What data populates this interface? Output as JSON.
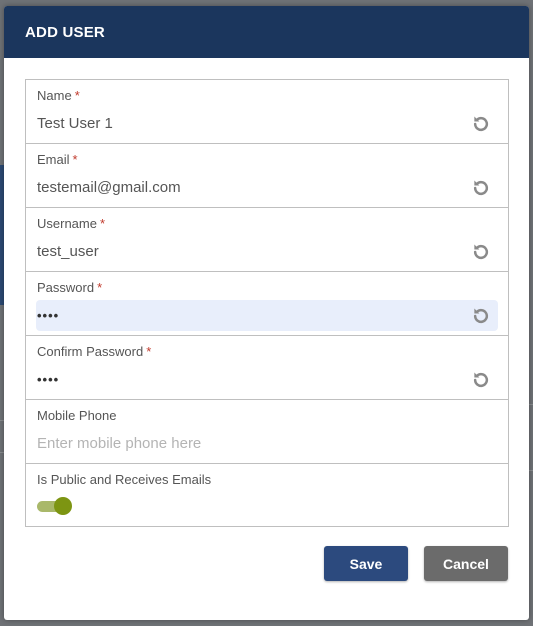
{
  "dialog": {
    "title": "ADD USER"
  },
  "fields": {
    "name": {
      "label": "Name",
      "required": "*",
      "value": "Test User 1"
    },
    "email": {
      "label": "Email",
      "required": "*",
      "value": "testemail@gmail.com"
    },
    "username": {
      "label": "Username",
      "required": "*",
      "value": "test_user"
    },
    "password": {
      "label": "Password",
      "required": "*",
      "value": "••••"
    },
    "confirm_password": {
      "label": "Confirm Password",
      "required": "*",
      "value": "••••"
    },
    "mobile_phone": {
      "label": "Mobile Phone",
      "value": "",
      "placeholder": "Enter mobile phone here"
    },
    "is_public": {
      "label": "Is Public and Receives Emails",
      "checked": true
    }
  },
  "buttons": {
    "save_label": "Save",
    "cancel_label": "Cancel"
  },
  "icons": {
    "reset": "reset-icon"
  },
  "colors": {
    "header_bg": "#1b365d",
    "save_bg": "#2c4a7e",
    "cancel_bg": "#6b6b6b",
    "required": "#c0392b",
    "toggle_on": "#7d9512",
    "focus_bg": "#e8eefb"
  }
}
